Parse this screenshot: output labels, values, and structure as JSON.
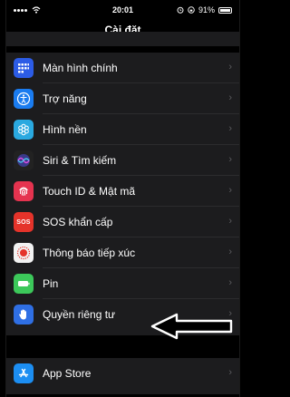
{
  "status": {
    "time": "20:01",
    "battery": "91%"
  },
  "header": {
    "title": "Cài đặt"
  },
  "settings": [
    {
      "label": "Màn hình chính",
      "icon": "home-screen-icon",
      "color": "#2c5ce6"
    },
    {
      "label": "Trợ năng",
      "icon": "accessibility-icon",
      "color": "#1a7cf0"
    },
    {
      "label": "Hình nền",
      "icon": "wallpaper-icon",
      "color": "#2aa9e0"
    },
    {
      "label": "Siri & Tìm kiếm",
      "icon": "siri-icon",
      "color": "#222"
    },
    {
      "label": "Touch ID & Mật mã",
      "icon": "fingerprint-icon",
      "color": "#e5334f"
    },
    {
      "label": "SOS khẩn cấp",
      "icon": "sos-icon",
      "color": "#e5332a"
    },
    {
      "label": "Thông báo tiếp xúc",
      "icon": "exposure-icon",
      "color": "#f2f2f2"
    },
    {
      "label": "Pin",
      "icon": "battery-icon",
      "color": "#3cc85a"
    },
    {
      "label": "Quyền riêng tư",
      "icon": "privacy-hand-icon",
      "color": "#2f6fe4"
    }
  ],
  "store": {
    "label": "App Store",
    "icon": "app-store-icon",
    "color": "#1c8ef2"
  },
  "annotation": {
    "icon": "left-arrow-icon"
  }
}
